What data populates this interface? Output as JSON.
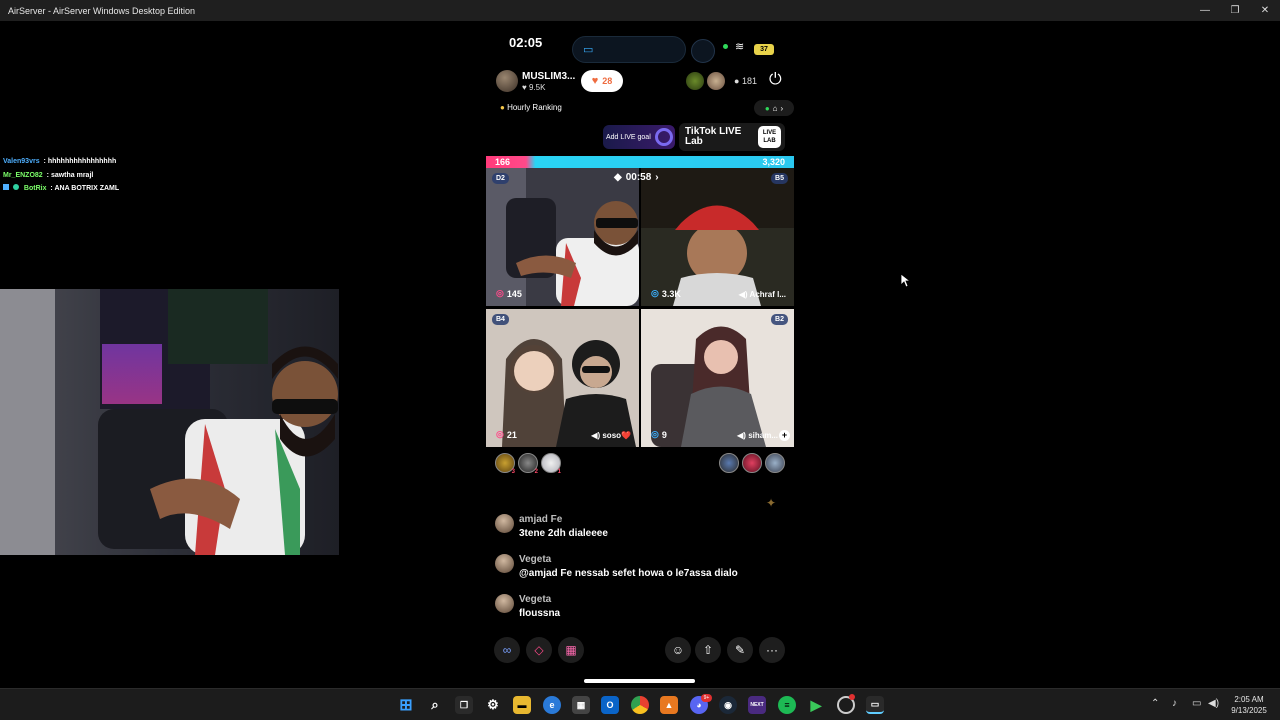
{
  "window": {
    "title": "AirServer - AirServer Windows Desktop Edition",
    "minimize": "—",
    "maximize": "❐",
    "close": "✕"
  },
  "chat_overlay": [
    {
      "user": "Valen93vrs",
      "sep": ":",
      "text": "hhhhhhhhhhhhhhhh",
      "user_color": "#4fb0ff"
    },
    {
      "user": "Mr_ENZO82",
      "sep": ":",
      "text": "sawtha mrajl",
      "user_color": "#7cff6a"
    },
    {
      "user": "BotRix",
      "sep": ":",
      "text": "ANA BOTRIX ZAML",
      "user_color": "#7cff6a"
    }
  ],
  "phone": {
    "status": {
      "time": "02:05",
      "battery": "37"
    },
    "host": {
      "name": "MUSLIM3...",
      "likes": "9.5K",
      "like_count": "28",
      "viewers": "181"
    },
    "ranking": {
      "label": "Hourly Ranking"
    },
    "goal_label": "Add LIVE goal",
    "live_lab": {
      "line1": "TikTok LIVE",
      "line2": "Lab",
      "logo": "LIVE LAB"
    },
    "battle": {
      "left_score": "166",
      "right_score": "3,320",
      "timer": "00:58"
    },
    "tiles": [
      {
        "rank": "D2",
        "score": "145",
        "guest": ""
      },
      {
        "rank": "B5",
        "score": "3.3K",
        "guest": "Achraf l..."
      },
      {
        "rank": "B4",
        "score": "21",
        "guest": "soso❤️"
      },
      {
        "rank": "B2",
        "score": "9",
        "guest": "siham..."
      }
    ],
    "gifters_left": [
      "3",
      "2",
      "1"
    ],
    "comments": [
      {
        "user": "amjad Fe",
        "text": "3tene 2dh dialeeee"
      },
      {
        "user": "Vegeta",
        "text": "@amjad Fe nessab sefet  howa o le7assa dialo"
      },
      {
        "user": "Vegeta",
        "text": "floussna"
      }
    ]
  },
  "taskbar": {
    "clock_time": "2:05 AM",
    "clock_date": "9/13/2025",
    "badge_count": "9+",
    "next_label": "NEXT"
  },
  "colors": {
    "battle_left": "#ff3a7a",
    "battle_right": "#2ac8f0",
    "like_accent": "#ee6b3f",
    "taskbar_bg": "#1c1c1c"
  }
}
